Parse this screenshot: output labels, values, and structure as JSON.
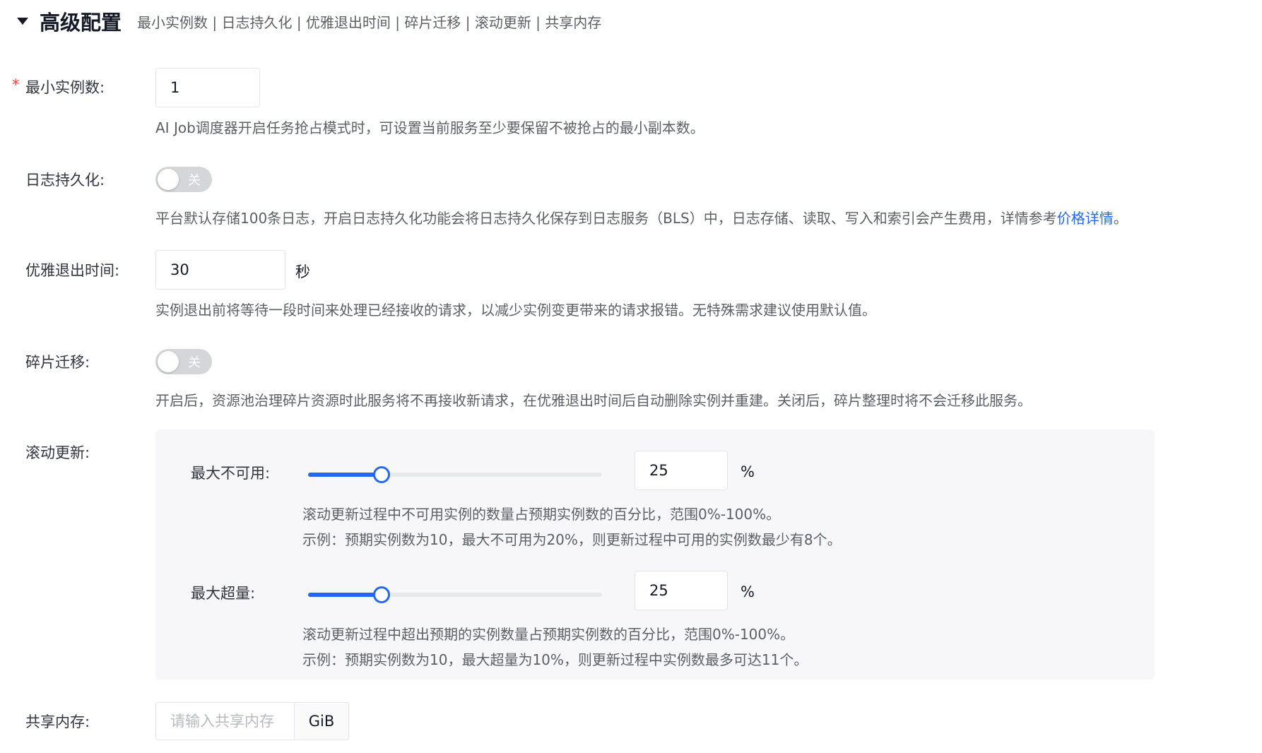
{
  "header": {
    "title": "高级配置",
    "summary": "最小实例数 | 日志持久化 | 优雅退出时间 | 碎片迁移 | 滚动更新 | 共享内存"
  },
  "min_instances": {
    "required_mark": "*",
    "label": "最小实例数:",
    "value": "1",
    "help": "AI Job调度器开启任务抢占模式时，可设置当前服务至少要保留不被抢占的最小副本数。"
  },
  "log_persist": {
    "label": "日志持久化:",
    "switch_text": "关",
    "enabled": false,
    "help_prefix": "平台默认存储100条日志，开启日志持久化功能会将日志持久化保存到日志服务（BLS）中，日志存储、读取、写入和索引会产生费用，详情参考",
    "help_link": "价格详情",
    "help_suffix": "。"
  },
  "graceful_exit": {
    "label": "优雅退出时间:",
    "value": "30",
    "unit": "秒",
    "help": "实例退出前将等待一段时间来处理已经接收的请求，以减少实例变更带来的请求报错。无特殊需求建议使用默认值。"
  },
  "fragment_migration": {
    "label": "碎片迁移:",
    "switch_text": "关",
    "enabled": false,
    "help": "开启后，资源池治理碎片资源时此服务将不再接收新请求，在优雅退出时间后自动删除实例并重建。关闭后，碎片整理时将不会迁移此服务。"
  },
  "rolling_update": {
    "label": "滚动更新:",
    "max_unavailable": {
      "label": "最大不可用:",
      "value": "25",
      "percent": 25,
      "unit": "%",
      "help_line1": "滚动更新过程中不可用实例的数量占预期实例数的百分比，范围0%-100%。",
      "help_line2": "示例：预期实例数为10，最大不可用为20%，则更新过程中可用的实例数最少有8个。"
    },
    "max_surge": {
      "label": "最大超量:",
      "value": "25",
      "percent": 25,
      "unit": "%",
      "help_line1": "滚动更新过程中超出预期的实例数量占预期实例数的百分比，范围0%-100%。",
      "help_line2": "示例：预期实例数为10，最大超量为10%，则更新过程中实例数最多可达11个。"
    }
  },
  "shared_memory": {
    "label": "共享内存:",
    "placeholder": "请输入共享内存",
    "unit": "GiB"
  },
  "colors": {
    "primary": "#2468f2",
    "required": "#f33e3e",
    "switch_off": "#d4d6d9"
  }
}
